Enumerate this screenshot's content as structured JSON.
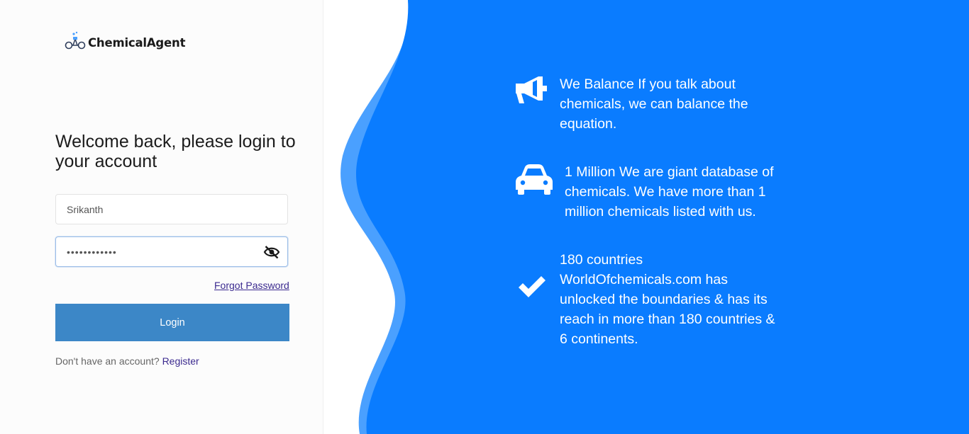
{
  "brand": {
    "name": "ChemicalAgent"
  },
  "login": {
    "heading": "Welcome back, please login to your account",
    "username_value": "Srikanth",
    "password_mask": "••••••••••••",
    "forgot_label": "Forgot Password",
    "login_label": "Login",
    "no_account_text": "Don't have an account?",
    "register_label": "Register"
  },
  "features": [
    {
      "icon": "megaphone-icon",
      "text": "We Balance If you talk about chemicals, we can balance the equation."
    },
    {
      "icon": "car-icon",
      "text": "1 Million We are giant database of chemicals. We have more than 1 million chemicals listed with us."
    },
    {
      "icon": "checkmark-icon",
      "text": "180 countries WorldOfchemicals.com has unlocked the boundaries & has its reach in more than 180 countries & 6 continents."
    }
  ],
  "colors": {
    "accent_blue": "#0a7cff",
    "wave_light_blue": "#4aa0ff",
    "login_button": "#3c87c7",
    "link": "#3b2a8f"
  }
}
